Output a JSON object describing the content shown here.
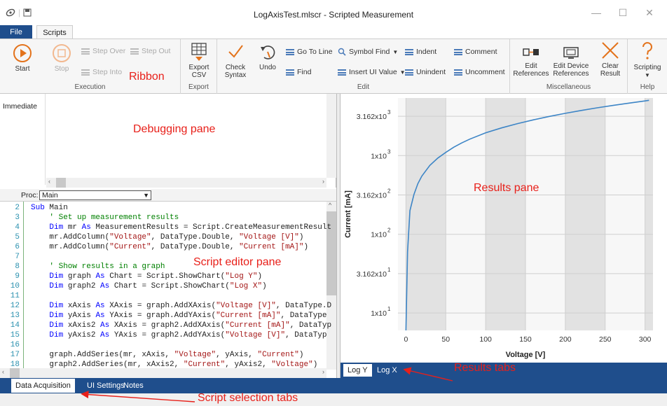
{
  "window": {
    "title": "LogAxisTest.mlscr - Scripted Measurement",
    "minimize": "—",
    "maximize": "☐",
    "close": "✕"
  },
  "tabs": {
    "file": "File",
    "scripts": "Scripts"
  },
  "ribbon": {
    "execution": {
      "label": "Execution",
      "start": "Start",
      "stop": "Stop",
      "step_over": "Step Over",
      "step_out": "Step Out",
      "step_into": "Step Into"
    },
    "export": {
      "label": "Export",
      "export_csv_1": "Export",
      "export_csv_2": "CSV"
    },
    "edit": {
      "label": "Edit",
      "check_syntax_1": "Check",
      "check_syntax_2": "Syntax",
      "undo": "Undo",
      "go_to_line": "Go To Line",
      "find": "Find",
      "symbol_find": "Symbol Find",
      "insert_ui_value": "Insert UI Value",
      "indent": "Indent",
      "unindent": "Unindent",
      "comment": "Comment",
      "uncomment": "Uncomment"
    },
    "misc": {
      "label": "Miscellaneous",
      "edit_references_1": "Edit",
      "edit_references_2": "References",
      "edit_device_references_1": "Edit Device",
      "edit_device_references_2": "References",
      "clear_result_1": "Clear",
      "clear_result_2": "Result"
    },
    "help": {
      "label": "Help",
      "scripting": "Scripting"
    }
  },
  "annotations": {
    "ribbon": "Ribbon",
    "debugging_pane": "Debugging pane",
    "script_editor_pane": "Script editor pane",
    "results_pane": "Results pane",
    "results_tabs": "Results tabs",
    "script_selection_tabs": "Script selection tabs"
  },
  "immediate": {
    "label": "Immediate"
  },
  "proc": {
    "label": "Proc:",
    "value": "Main"
  },
  "editor": {
    "lines": [
      {
        "n": "2",
        "t": "Sub Main"
      },
      {
        "n": "3",
        "t": "    ' Set up measurement results"
      },
      {
        "n": "4",
        "t": "    Dim mr As MeasurementResults = Script.CreateMeasurementResult"
      },
      {
        "n": "5",
        "t": "    mr.AddColumn(\"Voltage\", DataType.Double, \"Voltage [V]\")"
      },
      {
        "n": "6",
        "t": "    mr.AddColumn(\"Current\", DataType.Double, \"Current [mA]\")"
      },
      {
        "n": "7",
        "t": ""
      },
      {
        "n": "8",
        "t": "    ' Show results in a graph"
      },
      {
        "n": "9",
        "t": "    Dim graph As Chart = Script.ShowChart(\"Log Y\")"
      },
      {
        "n": "10",
        "t": "    Dim graph2 As Chart = Script.ShowChart(\"Log X\")"
      },
      {
        "n": "11",
        "t": ""
      },
      {
        "n": "12",
        "t": "    Dim xAxis As XAxis = graph.AddXAxis(\"Voltage [V]\", DataType.D"
      },
      {
        "n": "13",
        "t": "    Dim yAxis As YAxis = graph.AddYAxis(\"Current [mA]\", DataType"
      },
      {
        "n": "14",
        "t": "    Dim xAxis2 As XAxis = graph2.AddXAxis(\"Current [mA]\", DataTyp"
      },
      {
        "n": "15",
        "t": "    Dim yAxis2 As YAxis = graph2.AddYAxis(\"Voltage [V]\", DataTyp"
      },
      {
        "n": "16",
        "t": ""
      },
      {
        "n": "17",
        "t": "    graph.AddSeries(mr, xAxis, \"Voltage\", yAxis, \"Current\")"
      },
      {
        "n": "18",
        "t": "    graph2.AddSeries(mr, xAxis2, \"Current\", yAxis2, \"Voltage\")"
      }
    ]
  },
  "results_tabs": [
    "Log Y",
    "Log X"
  ],
  "bottom_tabs": [
    "Data Acquisition",
    "UI Settings",
    "Notes"
  ],
  "colors": {
    "accent": "#1f4e8c",
    "annotation": "#e8201a",
    "series": "#3d85c6"
  },
  "chart_data": {
    "type": "line",
    "xlabel": "Voltage [V]",
    "ylabel": "Current [mA]",
    "yscale": "log",
    "xlim": [
      -10,
      310
    ],
    "ylim": [
      6,
      5400
    ],
    "x_ticks": [
      0,
      50,
      100,
      150,
      200,
      250,
      300
    ],
    "y_ticks": [
      {
        "v": 10,
        "base": "1x10",
        "exp": "1"
      },
      {
        "v": 31.62,
        "base": "3.162x10",
        "exp": "1"
      },
      {
        "v": 100,
        "base": "1x10",
        "exp": "2"
      },
      {
        "v": 316.2,
        "base": "3.162x10",
        "exp": "2"
      },
      {
        "v": 1000,
        "base": "1x10",
        "exp": "3"
      },
      {
        "v": 3162,
        "base": "3.162x10",
        "exp": "3"
      }
    ],
    "x": [
      0,
      2,
      5,
      10,
      15,
      20,
      30,
      40,
      50,
      60,
      70,
      80,
      100,
      120,
      140,
      160,
      180,
      200,
      220,
      240,
      260,
      280,
      300,
      305
    ],
    "y": [
      6,
      60,
      200,
      320,
      440,
      550,
      750,
      930,
      1100,
      1280,
      1450,
      1620,
      1950,
      2250,
      2550,
      2850,
      3150,
      3450,
      3750,
      4050,
      4350,
      4650,
      4950,
      5050
    ],
    "grid": true
  }
}
